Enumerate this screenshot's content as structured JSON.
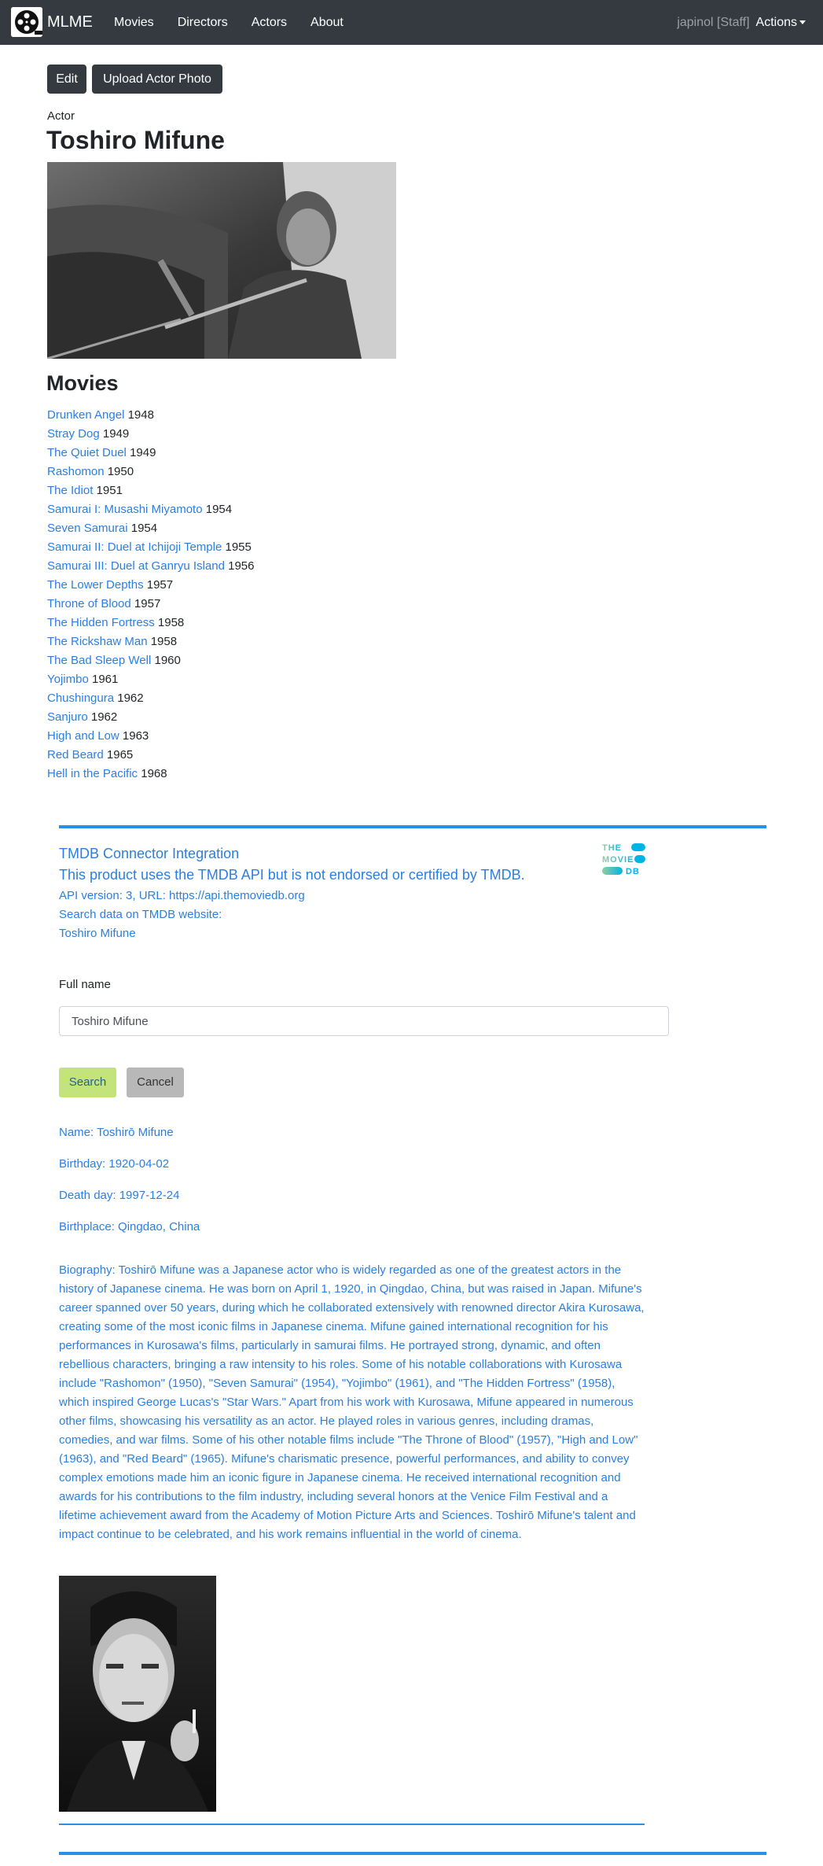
{
  "navbar": {
    "brand": "MLME",
    "links": [
      "Movies",
      "Directors",
      "Actors",
      "About"
    ],
    "user": "japinol [Staff]",
    "actions": "Actions"
  },
  "toolbar": {
    "edit_label": "Edit",
    "upload_label": "Upload Actor Photo"
  },
  "actor": {
    "role": "Actor",
    "name": "Toshiro Mifune"
  },
  "movies": {
    "heading": "Movies",
    "items": [
      {
        "title": "Drunken Angel",
        "year": "1948"
      },
      {
        "title": "Stray Dog",
        "year": "1949"
      },
      {
        "title": "The Quiet Duel",
        "year": "1949"
      },
      {
        "title": "Rashomon",
        "year": "1950"
      },
      {
        "title": "The Idiot",
        "year": "1951"
      },
      {
        "title": "Samurai I: Musashi Miyamoto",
        "year": "1954"
      },
      {
        "title": "Seven Samurai",
        "year": "1954"
      },
      {
        "title": "Samurai II: Duel at Ichijoji Temple",
        "year": "1955"
      },
      {
        "title": "Samurai III: Duel at Ganryu Island",
        "year": "1956"
      },
      {
        "title": "The Lower Depths",
        "year": "1957"
      },
      {
        "title": "Throne of Blood",
        "year": "1957"
      },
      {
        "title": "The Hidden Fortress",
        "year": "1958"
      },
      {
        "title": "The Rickshaw Man",
        "year": "1958"
      },
      {
        "title": "The Bad Sleep Well",
        "year": "1960"
      },
      {
        "title": "Yojimbo",
        "year": "1961"
      },
      {
        "title": "Chushingura",
        "year": "1962"
      },
      {
        "title": "Sanjuro",
        "year": "1962"
      },
      {
        "title": "High and Low",
        "year": "1963"
      },
      {
        "title": "Red Beard",
        "year": "1965"
      },
      {
        "title": "Hell in the Pacific",
        "year": "1968"
      }
    ]
  },
  "tmdb": {
    "title": "TMDB Connector Integration",
    "disclaimer": "This product uses the TMDB API but is not endorsed or certified by TMDB.",
    "api_info": "API version: 3, URL: https://api.themoviedb.org",
    "search_label": "Search data on TMDB website:",
    "search_link": "Toshiro Mifune",
    "logo_lines": [
      "THE",
      "MOVIE",
      "DB"
    ],
    "form": {
      "field_label": "Full name",
      "field_value": "Toshiro Mifune",
      "search_label": "Search",
      "cancel_label": "Cancel"
    },
    "result": {
      "name": "Name: Toshirō Mifune",
      "birthday": "Birthday: 1920-04-02",
      "death_day": "Death day: 1997-12-24",
      "birthplace": "Birthplace: Qingdao, China",
      "biography": "Biography: Toshirō Mifune was a Japanese actor who is widely regarded as one of the greatest actors in the history of Japanese cinema. He was born on April 1, 1920, in Qingdao, China, but was raised in Japan. Mifune's career spanned over 50 years, during which he collaborated extensively with renowned director Akira Kurosawa, creating some of the most iconic films in Japanese cinema. Mifune gained international recognition for his performances in Kurosawa's films, particularly in samurai films. He portrayed strong, dynamic, and often rebellious characters, bringing a raw intensity to his roles. Some of his notable collaborations with Kurosawa include \"Rashomon\" (1950), \"Seven Samurai\" (1954), \"Yojimbo\" (1961), and \"The Hidden Fortress\" (1958), which inspired George Lucas's \"Star Wars.\" Apart from his work with Kurosawa, Mifune appeared in numerous other films, showcasing his versatility as an actor. He played roles in various genres, including dramas, comedies, and war films. Some of his other notable films include \"The Throne of Blood\" (1957), \"High and Low\" (1963), and \"Red Beard\" (1965). Mifune's charismatic presence, powerful performances, and ability to convey complex emotions made him an iconic figure in Japanese cinema. He received international recognition and awards for his contributions to the film industry, including several honors at the Venice Film Festival and a lifetime achievement award from the Academy of Motion Picture Arts and Sciences. Toshirō Mifune's talent and impact continue to be celebrated, and his work remains influential in the world of cinema."
    }
  },
  "colors": {
    "navbar": "#343a40",
    "link": "#2b7fe0",
    "tmdb_line": "#2b8fe6",
    "search_button": "#c3e47a",
    "cancel_button": "#b8b8b8"
  }
}
